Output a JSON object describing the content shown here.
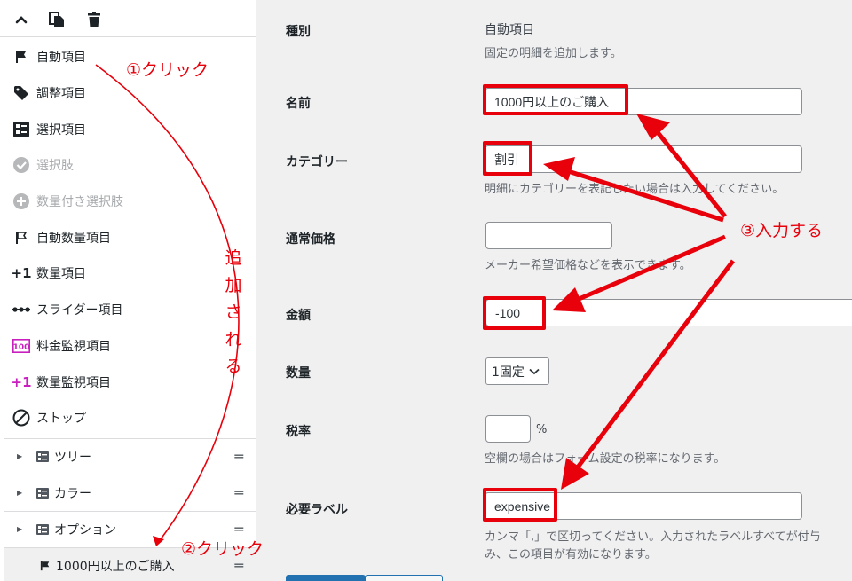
{
  "toolbar": {
    "collapse_icon": "chevron-up-icon",
    "copy_icon": "copy-icon",
    "delete_icon": "trash-icon"
  },
  "menu_items": [
    {
      "label": "自動項目",
      "icon": "flag-solid-icon",
      "disabled": false
    },
    {
      "label": "調整項目",
      "icon": "tag-icon",
      "disabled": false
    },
    {
      "label": "選択項目",
      "icon": "select-list-icon",
      "disabled": false
    },
    {
      "label": "選択肢",
      "icon": "check-circle-icon",
      "disabled": true
    },
    {
      "label": "数量付き選択肢",
      "icon": "plus-circle-icon",
      "disabled": true
    },
    {
      "label": "自動数量項目",
      "icon": "flag-outline-icon",
      "disabled": false
    },
    {
      "label": "数量項目",
      "icon": "plus-one-icon",
      "disabled": false
    },
    {
      "label": "スライダー項目",
      "icon": "slider-dots-icon",
      "disabled": false
    },
    {
      "label": "料金監視項目",
      "icon": "price-monitor-icon",
      "disabled": false
    },
    {
      "label": "数量監視項目",
      "icon": "plus-one-pink-icon",
      "disabled": false
    },
    {
      "label": "ストップ",
      "icon": "stop-icon",
      "disabled": false
    }
  ],
  "tree": [
    {
      "label": "ツリー"
    },
    {
      "label": "カラー"
    },
    {
      "label": "オプション"
    },
    {
      "label": "1000円以上のご購入",
      "selected": true
    }
  ],
  "form": {
    "type_label": "種別",
    "type_value": "自動項目",
    "type_desc": "固定の明細を追加します。",
    "name_label": "名前",
    "name_value": "1000円以上のご購入",
    "category_label": "カテゴリー",
    "category_value": "割引",
    "category_desc": "明細にカテゴリーを表記したい場合は入力してください。",
    "regular_price_label": "通常価格",
    "regular_price_value": "",
    "regular_price_desc": "メーカー希望価格などを表示できます。",
    "amount_label": "金額",
    "amount_value": "-100",
    "quantity_label": "数量",
    "quantity_value": "1固定",
    "tax_label": "税率",
    "tax_value": "",
    "tax_unit": "%",
    "tax_desc": "空欄の場合はフォーム設定の税率になります。",
    "required_label_label": "必要ラベル",
    "required_label_value": "expensive",
    "required_label_desc_1": "カンマ「,」で区切ってください。入力されたラベルすべてが付与",
    "required_label_desc_2": "み、この項目が有効になります。"
  },
  "annotations": {
    "step1": "①クリック",
    "step2": "②クリック",
    "step3": "③入力する",
    "added_chars": [
      "追",
      "加",
      "さ",
      "れ",
      "る"
    ]
  },
  "colors": {
    "annotation_red": "#e8000b",
    "primary_blue": "#2271b1",
    "pink_icon": "#c91fbf"
  }
}
